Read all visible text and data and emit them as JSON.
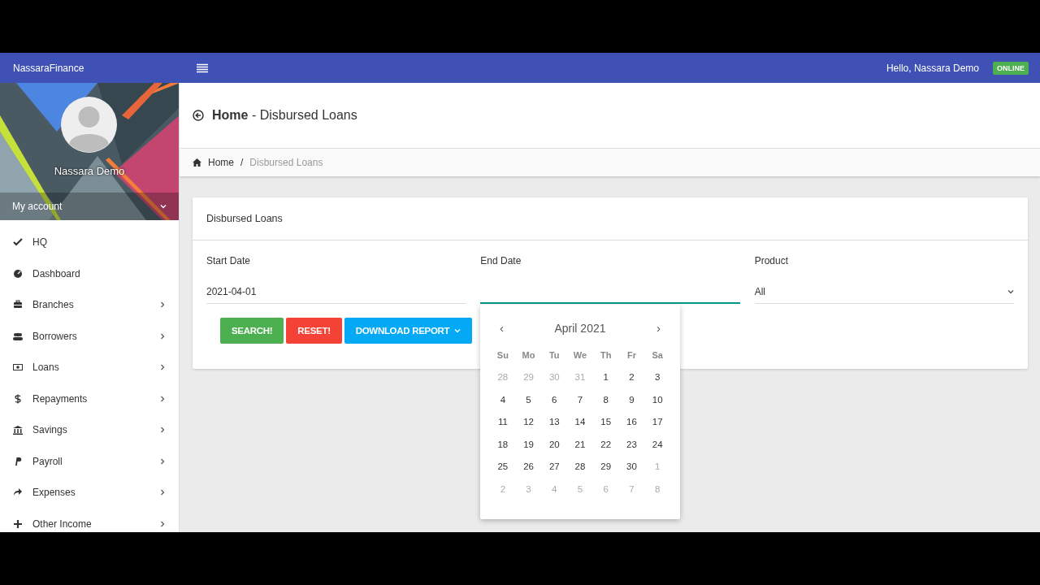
{
  "topbar": {
    "brand": "NassaraFinance",
    "greeting": "Hello, Nassara Demo",
    "status": "ONLINE"
  },
  "profile": {
    "kind": "picture",
    "name": "Nassara Demo",
    "account_label": "My account"
  },
  "sidebar": {
    "items": [
      {
        "label": "HQ",
        "expandable": false
      },
      {
        "label": "Dashboard",
        "expandable": false
      },
      {
        "label": "Branches",
        "expandable": true
      },
      {
        "label": "Borrowers",
        "expandable": true
      },
      {
        "label": "Loans",
        "expandable": true
      },
      {
        "label": "Repayments",
        "expandable": true
      },
      {
        "label": "Savings",
        "expandable": true
      },
      {
        "label": "Payroll",
        "expandable": true
      },
      {
        "label": "Expenses",
        "expandable": true
      },
      {
        "label": "Other Income",
        "expandable": true
      }
    ]
  },
  "page": {
    "title_bold": "Home",
    "title_rest": "- Disbursed Loans"
  },
  "breadcrumb": [
    {
      "label": "Home",
      "current": false
    },
    {
      "label": "/",
      "current": false
    },
    {
      "label": "Disbursed Loans",
      "current": true
    }
  ],
  "card": {
    "title": "Disbursed Loans",
    "fields": [
      {
        "label": "Start Date",
        "value": "2021-04-01",
        "kind": "text",
        "focused": false
      },
      {
        "label": "End Date",
        "kind": "text",
        "focused": true
      },
      {
        "label": "Product",
        "value": "All",
        "kind": "select",
        "focused": false
      }
    ],
    "buttons": [
      {
        "label": "SEARCH!",
        "color": "#4caf50",
        "dropdown": false
      },
      {
        "label": "RESET!",
        "color": "#f44336",
        "dropdown": false
      },
      {
        "label": "DOWNLOAD REPORT",
        "color": "#03a9f4",
        "dropdown": true
      }
    ]
  },
  "datepicker": {
    "prev": "‹",
    "month": "April 2021",
    "next": "›",
    "weekdays": [
      "Su",
      "Mo",
      "Tu",
      "We",
      "Th",
      "Fr",
      "Sa"
    ],
    "weeks": [
      [
        {
          "day": "28",
          "outside": true
        },
        {
          "day": "29",
          "outside": true
        },
        {
          "day": "30",
          "outside": true
        },
        {
          "day": "31",
          "outside": true
        },
        {
          "day": "1",
          "outside": false
        },
        {
          "day": "2",
          "outside": false
        },
        {
          "day": "3",
          "outside": false
        }
      ],
      [
        {
          "day": "4",
          "outside": false
        },
        {
          "day": "5",
          "outside": false
        },
        {
          "day": "6",
          "outside": false
        },
        {
          "day": "7",
          "outside": false
        },
        {
          "day": "8",
          "outside": false
        },
        {
          "day": "9",
          "outside": false
        },
        {
          "day": "10",
          "outside": false
        }
      ],
      [
        {
          "day": "11",
          "outside": false
        },
        {
          "day": "12",
          "outside": false
        },
        {
          "day": "13",
          "outside": false
        },
        {
          "day": "14",
          "outside": false
        },
        {
          "day": "15",
          "outside": false
        },
        {
          "day": "16",
          "outside": false
        },
        {
          "day": "17",
          "outside": false
        }
      ],
      [
        {
          "day": "18",
          "outside": false
        },
        {
          "day": "19",
          "outside": false
        },
        {
          "day": "20",
          "outside": false
        },
        {
          "day": "21",
          "outside": false
        },
        {
          "day": "22",
          "outside": false
        },
        {
          "day": "23",
          "outside": false
        },
        {
          "day": "24",
          "outside": false
        }
      ],
      [
        {
          "day": "25",
          "outside": false
        },
        {
          "day": "26",
          "outside": false
        },
        {
          "day": "27",
          "outside": false
        },
        {
          "day": "28",
          "outside": false
        },
        {
          "day": "29",
          "outside": false
        },
        {
          "day": "30",
          "outside": false
        },
        {
          "day": "1",
          "outside": true
        }
      ],
      [
        {
          "day": "2",
          "outside": true
        },
        {
          "day": "3",
          "outside": true
        },
        {
          "day": "4",
          "outside": true
        },
        {
          "day": "5",
          "outside": true
        },
        {
          "day": "6",
          "outside": true
        },
        {
          "day": "7",
          "outside": true
        },
        {
          "day": "8",
          "outside": true
        }
      ]
    ]
  }
}
